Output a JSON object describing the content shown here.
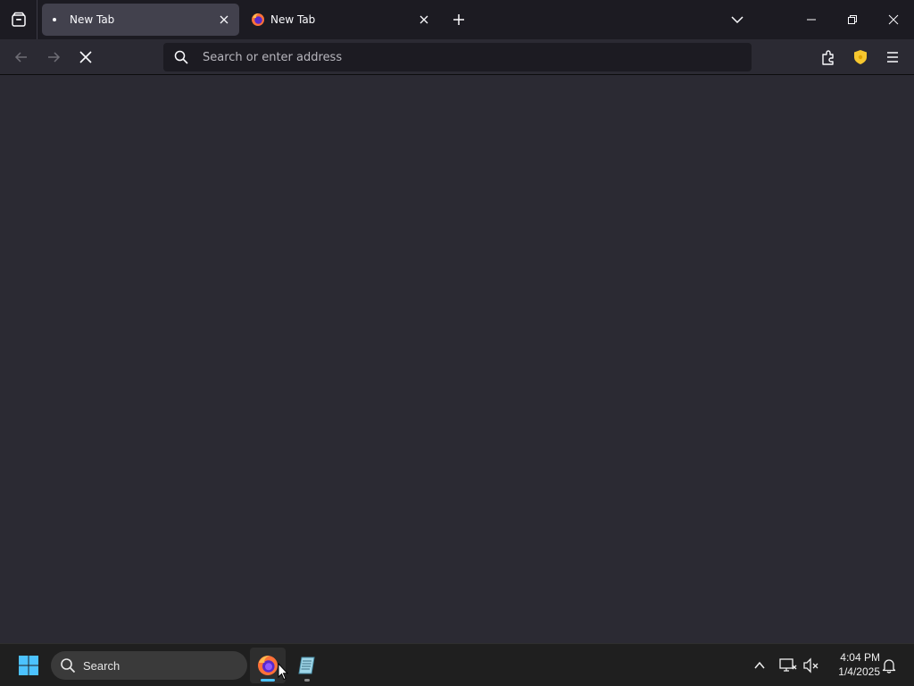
{
  "browser": {
    "tabs": [
      {
        "title": "New Tab",
        "selected": true,
        "favicon": "loading-dot-icon"
      },
      {
        "title": "New Tab",
        "selected": false,
        "favicon": "firefox-icon"
      }
    ],
    "toolbar": {
      "url_placeholder": "Search or enter address",
      "url_value": ""
    },
    "colors": {
      "tabstrip_bg": "#1c1b22",
      "selected_tab_bg": "#42414d",
      "content_bg": "#2b2a33",
      "shield_accent": "#f6c72f"
    }
  },
  "taskbar": {
    "search_label": "Search",
    "apps": [
      {
        "name": "Firefox",
        "icon": "firefox-icon",
        "active": true
      },
      {
        "name": "Notepad",
        "icon": "notepad-icon",
        "active": false
      }
    ],
    "clock": {
      "time": "4:04 PM",
      "date": "1/4/2025"
    },
    "colors": {
      "windows_logo": "#4cc2ff",
      "active_indicator": "#4cc2ff"
    }
  }
}
